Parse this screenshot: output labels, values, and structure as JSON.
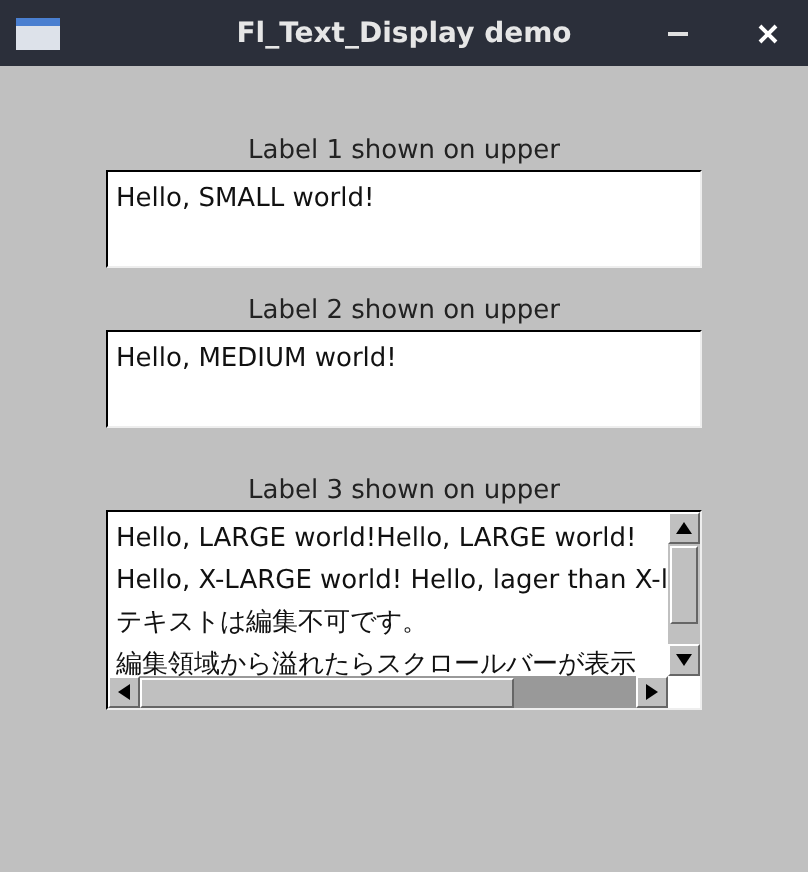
{
  "window": {
    "title": "Fl_Text_Display demo"
  },
  "displays": [
    {
      "label": "Label 1 shown on upper",
      "lines": [
        "Hello, SMALL world!"
      ],
      "kind": "small"
    },
    {
      "label": "Label 2 shown on upper",
      "lines": [
        "Hello, MEDIUM world!"
      ],
      "kind": "small"
    },
    {
      "label": "Label 3 shown on upper",
      "lines": [
        "Hello, LARGE world!Hello, LARGE world!",
        "Hello, X-LARGE world! Hello, lager than X-l",
        "テキストは編集不可です。",
        "編集領域から溢れたらスクロールバーが表示"
      ],
      "kind": "large"
    }
  ]
}
